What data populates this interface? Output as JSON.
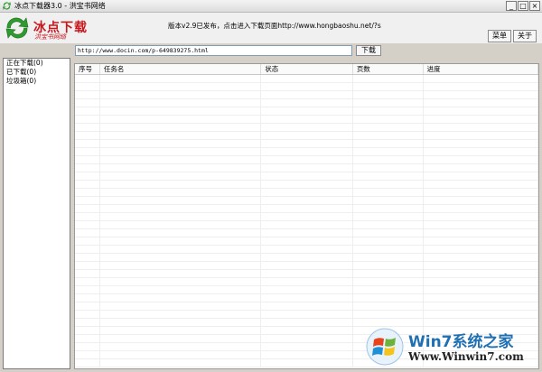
{
  "window": {
    "title": "冰点下载器3.0 - 洪宝书网络",
    "controls": [
      "_",
      "□",
      "×"
    ]
  },
  "header": {
    "brand": "冰点下载",
    "brand_sub": "洪宝书网络",
    "notice": "版本v2.9已发布，点击进入下载页面http://www.hongbaoshu.net/?s",
    "menu_label": "菜单",
    "about_label": "关于"
  },
  "url_bar": {
    "value": "http://www.docin.com/p-649839275.html",
    "download_label": "下载"
  },
  "sidebar": {
    "items": [
      {
        "label": "正在下载(0)"
      },
      {
        "label": "已下载(0)"
      },
      {
        "label": "垃圾箱(0)"
      }
    ]
  },
  "task_table": {
    "columns": [
      "序号",
      "任务名",
      "状态",
      "页数",
      "进度"
    ],
    "rows": []
  },
  "watermark": {
    "line1": "Win7系统之家",
    "line2": "Www.Winwin7.com"
  },
  "colors": {
    "brand_red": "#c8161d",
    "logo_green": "#2f9a2f",
    "watermark_blue": "#1f6fb3"
  }
}
